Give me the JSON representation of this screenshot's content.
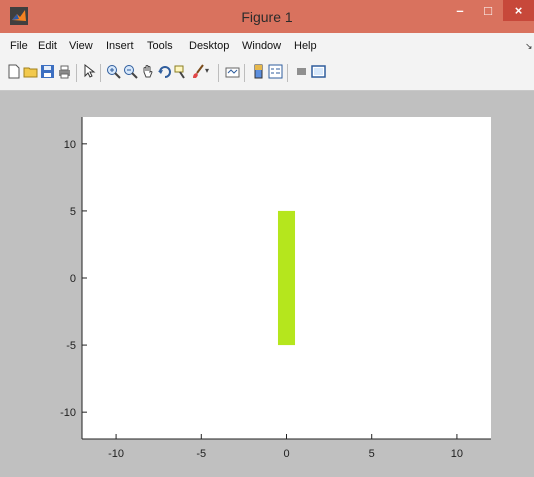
{
  "window": {
    "title": "Figure 1",
    "minimize_label": "–",
    "maximize_label": "□",
    "close_label": "×"
  },
  "menu": {
    "items": [
      "File",
      "Edit",
      "View",
      "Insert",
      "Tools",
      "Desktop",
      "Window",
      "Help"
    ]
  },
  "toolbar": {
    "icons": [
      "new-figure-icon",
      "open-file-icon",
      "save-icon",
      "print-icon",
      "edit-plot-icon",
      "zoom-in-icon",
      "zoom-out-icon",
      "pan-icon",
      "rotate-3d-icon",
      "data-cursor-icon",
      "brush-icon",
      "link-plot-icon",
      "colorbar-icon",
      "legend-icon",
      "hide-plot-tools-icon",
      "show-plot-tools-icon"
    ]
  },
  "colors": {
    "titlebar": "#d9725e",
    "close_button": "#c7483a",
    "plot_background": "#ffffff",
    "figure_background": "#c0c0c0",
    "bar_fill": "#b5e61d"
  },
  "chart_data": {
    "type": "area",
    "x_ticks": [
      -10,
      -5,
      0,
      5,
      10
    ],
    "y_ticks": [
      -10,
      -5,
      0,
      5,
      10
    ],
    "xlim": [
      -12,
      12
    ],
    "ylim": [
      -12,
      12
    ],
    "grid": false,
    "rectangle": {
      "x_min": -0.5,
      "x_max": 0.5,
      "y_min": -5,
      "y_max": 5,
      "color": "#b5e61d"
    }
  }
}
